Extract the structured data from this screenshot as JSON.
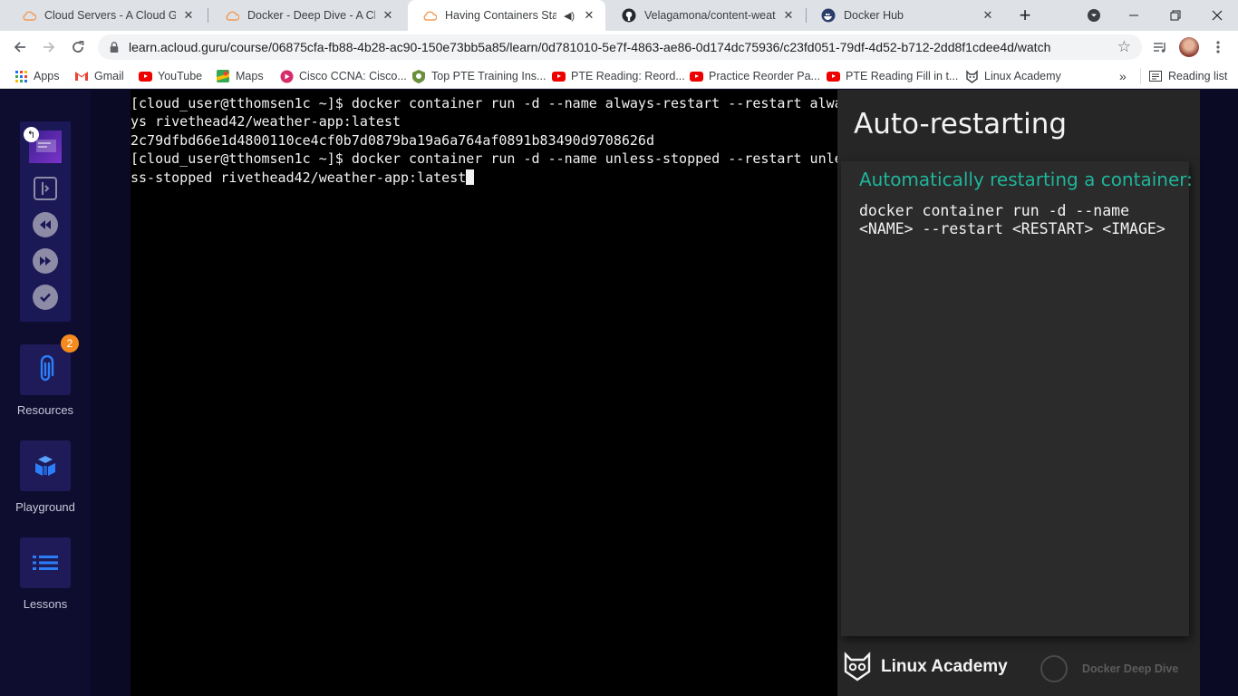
{
  "browser": {
    "tabs": [
      {
        "title": "Cloud Servers - A Cloud Guru",
        "icon": "acg-cloud-icon",
        "active": false
      },
      {
        "title": "Docker - Deep Dive - A Cloud",
        "icon": "acg-cloud-icon",
        "active": false
      },
      {
        "title": "Having Containers Start A",
        "icon": "acg-cloud-icon",
        "active": true,
        "audio": true
      },
      {
        "title": "Velagamona/content-weathe",
        "icon": "github-icon",
        "active": false
      },
      {
        "title": "Docker Hub",
        "icon": "docker-hub-icon",
        "active": false
      }
    ],
    "url": "learn.acloud.guru/course/06875cfa-fb88-4b28-ac90-150e73bb5a85/learn/0d781010-5e7f-4863-ae86-0d174dc75936/c23fd051-79df-4d52-b712-2dd8f1cdee4d/watch",
    "bookmarks": [
      {
        "label": "Apps",
        "icon": "apps-grid-icon"
      },
      {
        "label": "Gmail",
        "icon": "gmail-icon"
      },
      {
        "label": "YouTube",
        "icon": "youtube-icon"
      },
      {
        "label": "Maps",
        "icon": "maps-icon"
      },
      {
        "label": "Cisco CCNA: Cisco...",
        "icon": "cisco-icon"
      },
      {
        "label": "Top PTE Training Ins...",
        "icon": "pte-icon"
      },
      {
        "label": "PTE Reading: Reord...",
        "icon": "youtube-icon"
      },
      {
        "label": "Practice Reorder Pa...",
        "icon": "youtube-icon"
      },
      {
        "label": "PTE Reading Fill in t...",
        "icon": "youtube-icon"
      },
      {
        "label": "Linux Academy",
        "icon": "linux-academy-icon"
      }
    ],
    "more_bookmarks": "»",
    "reading_list": "Reading list"
  },
  "sidebar": {
    "resources_label": "Resources",
    "resources_count": "2",
    "playground_label": "Playground",
    "lessons_label": "Lessons"
  },
  "terminal": {
    "lines": [
      "[cloud_user@tthomsen1c ~]$ docker container run -d --name always-restart --restart alwa",
      "ys rivethead42/weather-app:latest",
      "2c79dfbd66e1d4800110ce4cf0b7d0879ba19a6a764af0891b83490d9708626d",
      "[cloud_user@tthomsen1c ~]$ docker container run -d --name unless-stopped --restart unle",
      "ss-stopped rivethead42/weather-app:latest"
    ]
  },
  "slide": {
    "title": "Auto-restarting",
    "subtitle": "Automatically restarting a container:",
    "code_line1": "docker container run -d --name",
    "code_line2": "<NAME> --restart <RESTART> <IMAGE>",
    "brand": "Linux Academy",
    "course": "Docker Deep Dive"
  },
  "colors": {
    "page_bg": "#0b0a24",
    "sidebar_tile": "#1e1b58",
    "accent_teal": "#1fb59a",
    "badge_orange": "#f58b1f"
  }
}
